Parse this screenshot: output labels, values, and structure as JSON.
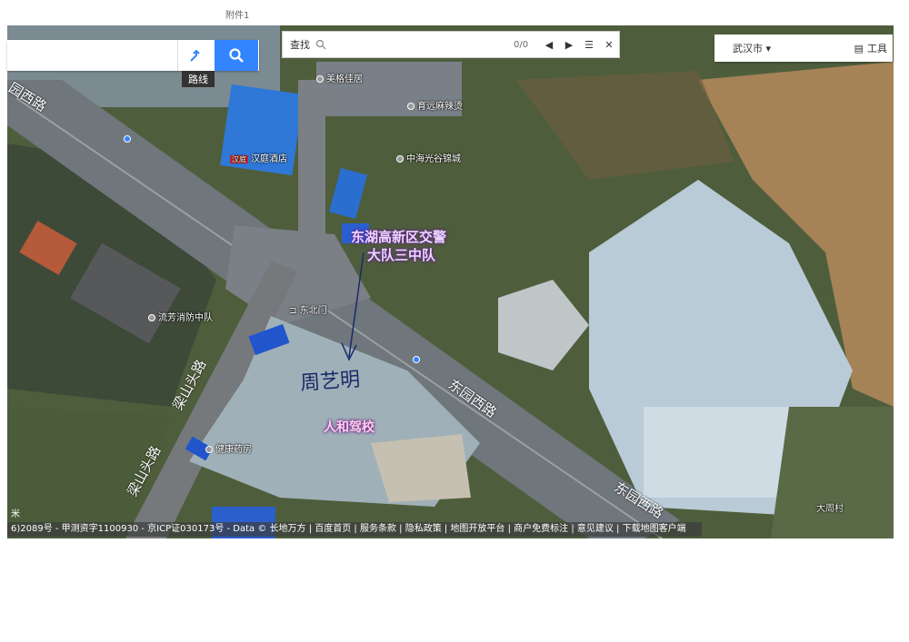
{
  "page_mark": "附件1",
  "route_label": "路线",
  "find": {
    "label": "查找",
    "count": "0/0"
  },
  "city": {
    "name": "武汉市",
    "tools": "工具"
  },
  "labels": {
    "meige": "美格佳居",
    "yuyuan": "育远麻辣烫",
    "hanting_badge": "汉庭",
    "hanting": "汉庭酒店",
    "zhonghai": "中海光谷锦城",
    "police1": "东湖高新区交警",
    "police2": "大队三中队",
    "dongbeimen": "东北门",
    "fire": "流芳消防中队",
    "school": "人和驾校",
    "pharmacy": "健康药房",
    "village": "大周村"
  },
  "roads": {
    "nw": "园西路",
    "main": "东园西路",
    "se": "东园西路",
    "liangshan1": "梁山头路",
    "liangshan2": "梁山头路"
  },
  "handwriting": "周艺明",
  "scale": "米",
  "footer": "6)2089号 - 甲测资字1100930 - 京ICP证030173号 - Data © 长地万方 | 百度首页 | 服务条款 | 隐私政策 | 地图开放平台 | 商户免费标注 | 意见建议 | 下载地图客户端",
  "colors": {
    "accent": "#3385ff",
    "label_purple": "#6a1c8a"
  }
}
